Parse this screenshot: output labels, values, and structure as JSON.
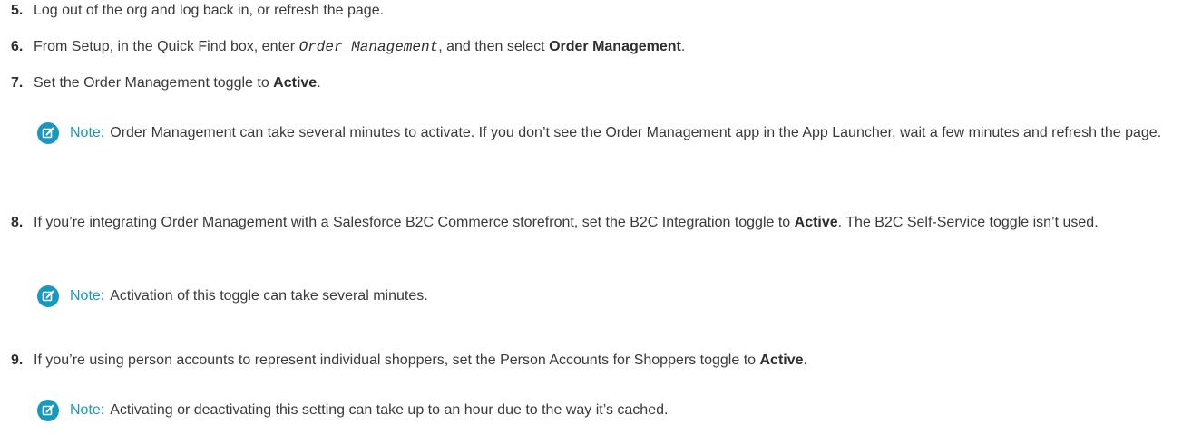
{
  "steps": [
    {
      "num": "5.",
      "text": "Log out of the org and log back in, or refresh the page."
    },
    {
      "num": "6.",
      "pre": "From Setup, in the Quick Find box, enter ",
      "code": "Order Management",
      "mid": ", and then select ",
      "bold": "Order Management",
      "post": "."
    },
    {
      "num": "7.",
      "pre": "Set the Order Management toggle to ",
      "bold": "Active",
      "post": "."
    },
    {
      "num": "8.",
      "pre": "If you’re integrating Order Management with a Salesforce B2C Commerce storefront, set the B2C Integration toggle to ",
      "bold": "Active",
      "post": ". The B2C Self-Service toggle isn’t used."
    },
    {
      "num": "9.",
      "pre": "If you’re using person accounts to represent individual shoppers, set the Person Accounts for Shoppers toggle to ",
      "bold": "Active",
      "post": "."
    }
  ],
  "notes": [
    {
      "label": "Note:",
      "text": "Order Management can take several minutes to activate. If you don’t see the Order Management app in the App Launcher, wait a few minutes and refresh the page."
    },
    {
      "label": "Note:",
      "text": "Activation of this toggle can take several minutes."
    },
    {
      "label": "Note:",
      "text": "Activating or deactivating this setting can take up to an hour due to the way it’s cached."
    }
  ],
  "colors": {
    "note_accent": "#1798c1",
    "text": "#3a3a3a"
  },
  "icon": "edit-note-icon"
}
